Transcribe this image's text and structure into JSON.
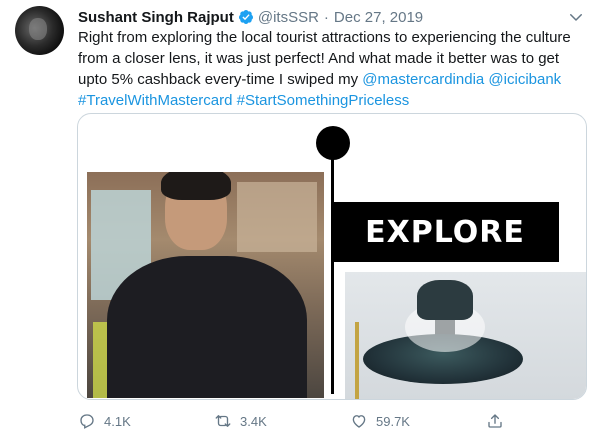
{
  "tweet": {
    "author_name": "Sushant Singh Rajput",
    "handle": "@itsSSR",
    "separator": "·",
    "date": "Dec 27, 2019",
    "text_lines": [
      "Right from exploring the local tourist attractions to experiencing the culture",
      "from a closer lens, it was just perfect! And what made it better was to get",
      "upto 5% cashback every-time I swiped my "
    ],
    "mention_1": "@mastercardindia",
    "mention_2": "@icicibank",
    "hashtag_1": "#TravelWithMastercard",
    "hashtag_2": "#StartSomethingPriceless"
  },
  "media": {
    "banner_text": "EXPLORE"
  },
  "actions": {
    "reply_count": "4.1K",
    "retweet_count": "3.4K",
    "like_count": "59.7K"
  },
  "colors": {
    "link": "#1b95e0",
    "secondary_text": "#657786",
    "verified": "#1da1f2"
  },
  "icons": [
    "verified-badge-icon",
    "chevron-down-icon",
    "reply-icon",
    "retweet-icon",
    "like-icon",
    "share-icon"
  ]
}
